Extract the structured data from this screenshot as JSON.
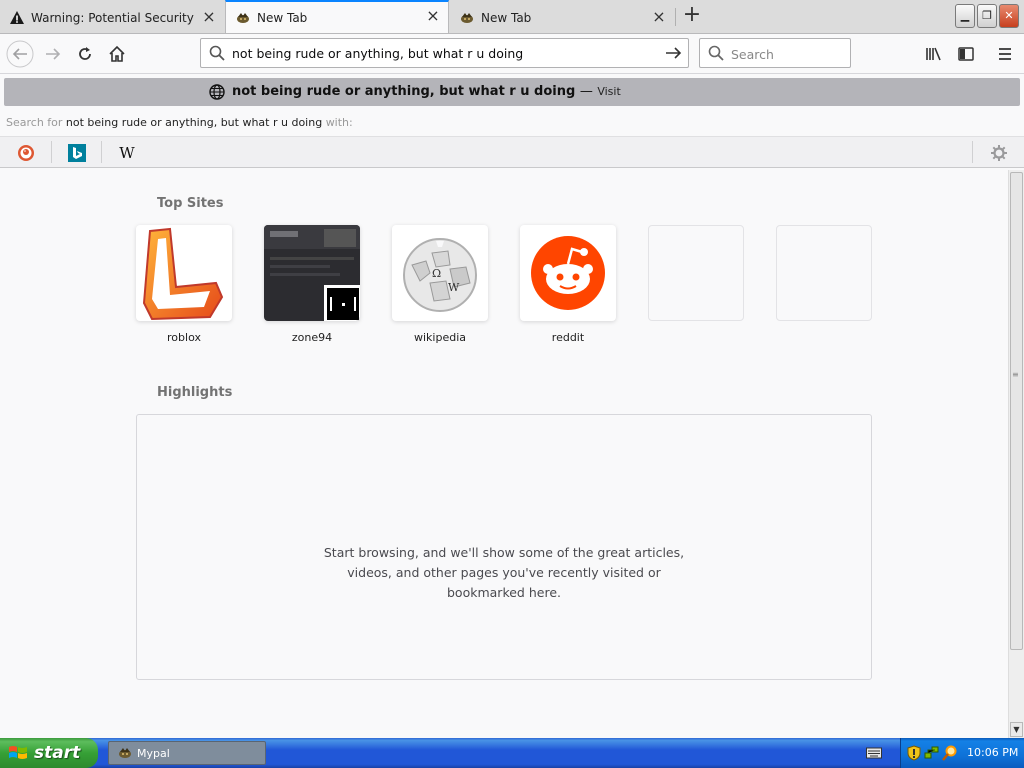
{
  "tabs": [
    {
      "title": "Warning: Potential Security Risk Ah",
      "icon": "warning-icon",
      "active": false
    },
    {
      "title": "New Tab",
      "icon": "mypal-icon",
      "active": true
    },
    {
      "title": "New Tab",
      "icon": "mypal-icon",
      "active": false
    }
  ],
  "navbar": {
    "url_value": "not being rude or anything, but what r u doing",
    "search_placeholder": "Search"
  },
  "suggestion": {
    "text": "not being rude or anything, but what r u doing",
    "separator": "—",
    "visit_label": "Visit"
  },
  "search_for": {
    "prefix": "Search for",
    "query": "not being rude or anything, but what r u doing",
    "suffix": "with:"
  },
  "engines": [
    "duckduckgo-icon",
    "bing-icon",
    "wikipedia-icon"
  ],
  "top_sites": {
    "title": "Top Sites",
    "tiles": [
      {
        "label": "roblox"
      },
      {
        "label": "zone94"
      },
      {
        "label": "wikipedia"
      },
      {
        "label": "reddit"
      },
      {
        "label": ""
      },
      {
        "label": ""
      }
    ]
  },
  "highlights": {
    "title": "Highlights",
    "message_line1": "Start browsing, and we'll show some of the great articles,",
    "message_line2": "videos, and other pages you've recently visited or",
    "message_line3": "bookmarked here."
  },
  "taskbar": {
    "start_label": "start",
    "window_label": "Mypal",
    "clock": "10:06 PM"
  },
  "colors": {
    "accent": "#0a84ff",
    "suggestion_bg": "#b4b4b9",
    "reddit": "#ff4500",
    "xp_start": "#36a036",
    "xp_taskbar": "#2157d7"
  }
}
